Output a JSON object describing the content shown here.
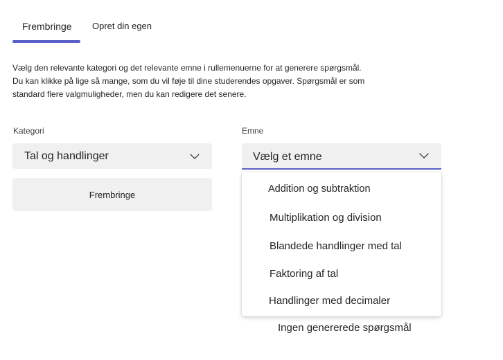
{
  "tabs": [
    {
      "label": "Frembringe",
      "active": true
    },
    {
      "label": "Opret din egen",
      "active": false
    }
  ],
  "description": {
    "line1": "Vælg den relevante kategori og det relevante emne i rullemenuerne for at generere spørgsmål.",
    "line2": "Du kan klikke på lige så mange, som du vil føje til dine studerendes opgaver. Spørgsmål er som",
    "line3": "standard flere valgmuligheder, men du kan redigere det senere."
  },
  "category": {
    "label": "Kategori",
    "value": "Tal og handlinger"
  },
  "topic": {
    "label": "Emne",
    "placeholder": "Vælg et emne",
    "options": [
      "Addition og subtraktion",
      "Multiplikation og division",
      "Blandede handlinger med tal",
      "Faktoring af tal",
      "Handlinger med decimaler"
    ]
  },
  "generate_button": "Frembringe",
  "empty_state": "Ingen genererede spørgsmål",
  "colors": {
    "accent": "#5b5fc7",
    "field_background": "#f0f0f0",
    "text": "#242424"
  },
  "icons": {
    "category_chevron": "chevron-down-icon",
    "topic_chevron": "chevron-down-icon"
  }
}
